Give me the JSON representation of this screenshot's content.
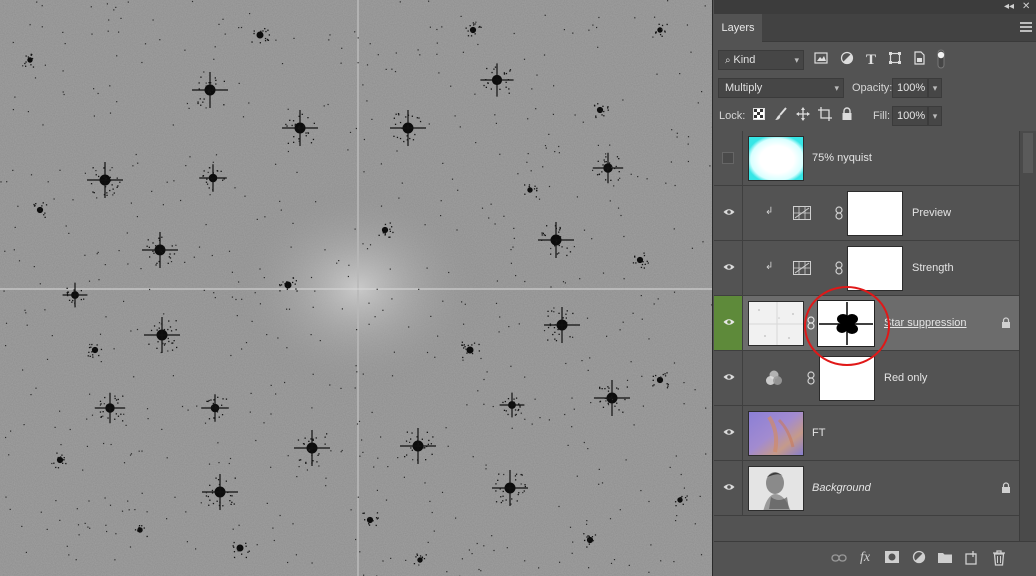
{
  "panel": {
    "tab_layers": "Layers",
    "filter_kind": "Kind",
    "blend_mode": "Multiply",
    "opacity_label": "Opacity:",
    "opacity_value": "100%",
    "lock_label": "Lock:",
    "fill_label": "Fill:",
    "fill_value": "100%"
  },
  "layers": [
    {
      "name": "75% nyquist",
      "visible": false,
      "selected": false,
      "italic": false,
      "locked": false
    },
    {
      "name": "Preview",
      "visible": true,
      "selected": false,
      "italic": false,
      "locked": false
    },
    {
      "name": "Strength",
      "visible": true,
      "selected": false,
      "italic": false,
      "locked": false
    },
    {
      "name": "Star suppression",
      "visible": true,
      "selected": true,
      "italic": false,
      "locked": true
    },
    {
      "name": "Red only",
      "visible": true,
      "selected": false,
      "italic": false,
      "locked": false
    },
    {
      "name": "FT",
      "visible": true,
      "selected": false,
      "italic": false,
      "locked": false
    },
    {
      "name": "Background",
      "visible": true,
      "selected": false,
      "italic": true,
      "locked": true
    }
  ],
  "colors": {
    "selected_eye_bg": "#5e8a3a",
    "annotation": "#e01818",
    "canvas_gray": "#8e8e8e"
  },
  "icons": {
    "filter": "search-icon",
    "pixel_filter": "image-icon",
    "adjustment_filter": "half-circle-icon",
    "type_filter": "type-icon",
    "shape_filter": "shape-icon",
    "smart_filter": "smart-object-icon",
    "toggle_filter": "toggle-icon"
  }
}
